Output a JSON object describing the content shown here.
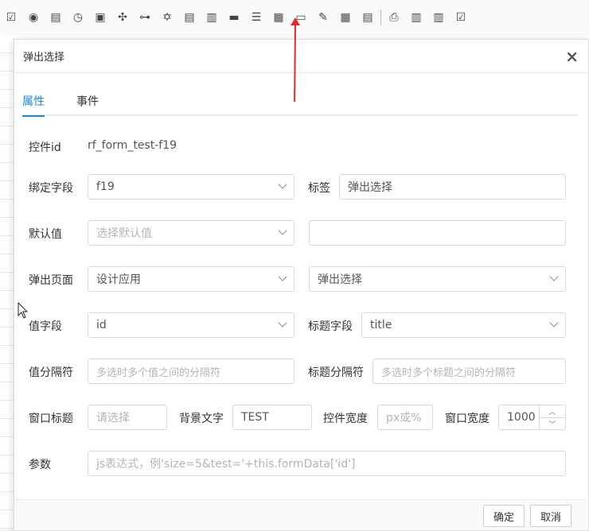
{
  "toolbar": {
    "icons": [
      "checkbox-icon",
      "radio-icon",
      "edit-icon",
      "clock-icon",
      "square-icon",
      "grid-dots-icon",
      "link-icon",
      "star-icon",
      "document-icon",
      "list-icon",
      "black-bar-icon",
      "list-lines-icon",
      "table-grid-icon",
      "popup-window-icon",
      "pencil-icon",
      "table-icon",
      "file-icon",
      "preview-icon",
      "save-icon",
      "save-as-icon",
      "check-square-icon"
    ],
    "glyphs": [
      "☑",
      "◉",
      "▤",
      "◷",
      "▣",
      "✣",
      "⊶",
      "✡",
      "▤",
      "▥",
      "▬",
      "☰",
      "▦",
      "▭",
      "✎",
      "▦",
      "▤",
      "⎙",
      "▥",
      "▥",
      "☑"
    ]
  },
  "modal": {
    "title": "弹出选择",
    "close": "×",
    "tabs": [
      "属性",
      "事件"
    ]
  },
  "form": {
    "control_id_label": "控件id",
    "control_id_value": "rf_form_test-f19",
    "bind_field_label": "绑定字段",
    "bind_field_value": "f19",
    "tag_label": "标签",
    "tag_value": "弹出选择",
    "default_label": "默认值",
    "default_placeholder": "选择默认值",
    "default_extra_value": "",
    "popup_page_label": "弹出页面",
    "popup_page_app": "设计应用",
    "popup_page_value": "弹出选择",
    "value_field_label": "值字段",
    "value_field_value": "id",
    "title_field_label": "标题字段",
    "title_field_value": "title",
    "value_sep_label": "值分隔符",
    "value_sep_placeholder": "多选时多个值之间的分隔符",
    "title_sep_label": "标题分隔符",
    "title_sep_placeholder": "多选时多个标题之间的分隔符",
    "window_title_label": "窗口标题",
    "window_title_placeholder": "请选择",
    "bg_text_label": "背景文字",
    "bg_text_value": "TEST",
    "control_width_label": "控件宽度",
    "control_width_placeholder": "px或%",
    "window_width_label": "窗口宽度",
    "window_width_value": "1000",
    "params_label": "参数",
    "params_placeholder": "js表达式，例'size=5&test='+this.formData['id']"
  },
  "footer": {
    "ok": "确定",
    "cancel": "取消"
  },
  "colors": {
    "accent": "#1e8ad6",
    "annotation_arrow": "#e12b2b"
  }
}
